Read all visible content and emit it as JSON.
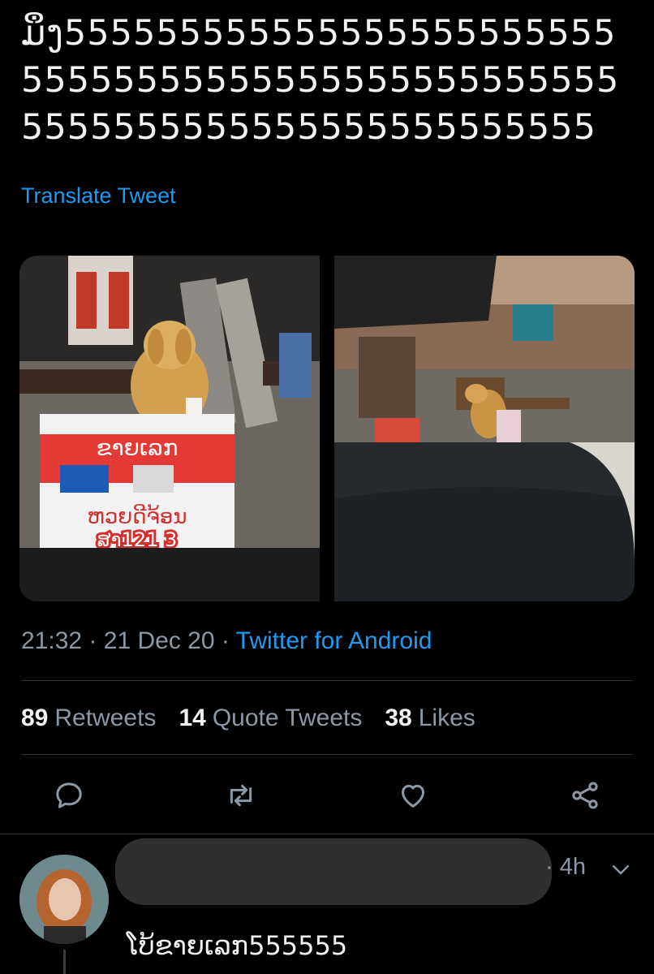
{
  "tweet": {
    "text": "ມຶງ555555555555555555555555555555555555555555555555555555555555555555555555555",
    "translate_label": "Translate Tweet",
    "time": "21:32",
    "date": "21 Dec 20",
    "separator": "·",
    "source": "Twitter for Android"
  },
  "media": {
    "photo1_sign_top": "ຂາຍເລກ",
    "photo1_sign_bottom": "ຫວຍດີຈ້ອນ",
    "photo1_sign_number": "ສາ121 3"
  },
  "stats": {
    "retweets_count": "89",
    "retweets_label": "Retweets",
    "quotes_count": "14",
    "quotes_label": "Quote Tweets",
    "likes_count": "38",
    "likes_label": "Likes"
  },
  "actions": [
    "reply-icon",
    "retweet-icon",
    "heart-icon",
    "share-icon"
  ],
  "reply": {
    "time": "· 4h",
    "text": "ໂບ້ຂາຍເລກ555555"
  },
  "colors": {
    "background": "#000000",
    "accent": "#1d9bf0",
    "muted": "#8b98a5"
  }
}
